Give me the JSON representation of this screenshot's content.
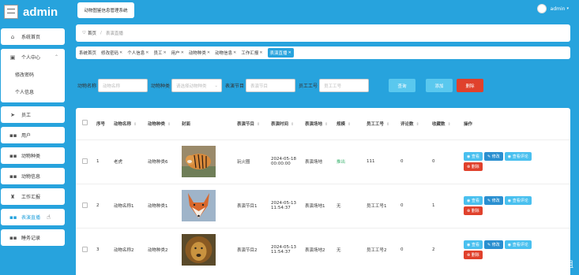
{
  "app": {
    "title": "admin",
    "system_name": "动物图鉴信息管理系统"
  },
  "user": {
    "name": "admin"
  },
  "sidebar": {
    "items": [
      {
        "label": "系统首页",
        "icon": "home-icon"
      },
      {
        "label": "个人中心",
        "icon": "calendar-icon"
      },
      {
        "label": "员工",
        "icon": "send-icon"
      },
      {
        "label": "用户",
        "icon": "grid-icon"
      },
      {
        "label": "动物种类",
        "icon": "grid-icon"
      },
      {
        "label": "动物信息",
        "icon": "grid-icon"
      },
      {
        "label": "工作汇报",
        "icon": "trophy-icon"
      },
      {
        "label": "表演直播",
        "icon": "grid-icon"
      },
      {
        "label": "睡务记录",
        "icon": "grid-icon"
      }
    ],
    "submenu": [
      {
        "label": "修改密码"
      },
      {
        "label": "个人信息"
      }
    ]
  },
  "breadcrumb": {
    "home": "首页",
    "current": "表演直播"
  },
  "tags": [
    {
      "label": "系统首页"
    },
    {
      "label": "修改密码"
    },
    {
      "label": "个人信息"
    },
    {
      "label": "员工"
    },
    {
      "label": "用户"
    },
    {
      "label": "动物种类"
    },
    {
      "label": "动物信息"
    },
    {
      "label": "工作汇报"
    },
    {
      "label": "表演直播"
    }
  ],
  "search": {
    "name_label": "动物名称",
    "name_placeholder": "动物名称",
    "type_label": "动物种类",
    "type_placeholder": "请选择动物种类",
    "program_label": "表演节目",
    "program_placeholder": "表演节目",
    "staff_label": "员工工号",
    "staff_placeholder": "员工工号",
    "search_btn": "查询",
    "add_btn": "添加",
    "delete_btn": "删除"
  },
  "table": {
    "headers": [
      "序号",
      "动物名称",
      "动物种类",
      "封面",
      "表演节目",
      "表演时间",
      "表演场地",
      "规模",
      "员工工号",
      "评论数",
      "收藏数",
      "操作"
    ],
    "rows": [
      {
        "no": "1",
        "name": "老虎",
        "type": "动物种类6",
        "program": "玩火圈",
        "time": "2024-05-18 00:00:00",
        "venue": "表演场地",
        "scale": "推出",
        "staff": "111",
        "comments": "0",
        "favorites": "0",
        "image": "tiger"
      },
      {
        "no": "2",
        "name": "动物名称1",
        "type": "动物种类1",
        "program": "表演节目1",
        "time": "2024-05-13 11:54:37",
        "venue": "表演场地1",
        "scale": "无",
        "staff": "员工工号1",
        "comments": "0",
        "favorites": "1",
        "image": "fox"
      },
      {
        "no": "3",
        "name": "动物名称2",
        "type": "动物种类2",
        "program": "表演节目2",
        "time": "2024-05-13 11:54:37",
        "venue": "表演场地2",
        "scale": "无",
        "staff": "员工工号2",
        "comments": "0",
        "favorites": "2",
        "image": "lion"
      }
    ],
    "ops": {
      "view": "查看",
      "edit": "修改",
      "comment": "查看评论",
      "delete": "删除"
    }
  },
  "watermark": "CSDN @学雨学姐",
  "colors": {
    "primary": "#27a3dd",
    "danger": "#e0412c",
    "success": "#3bb36f"
  }
}
